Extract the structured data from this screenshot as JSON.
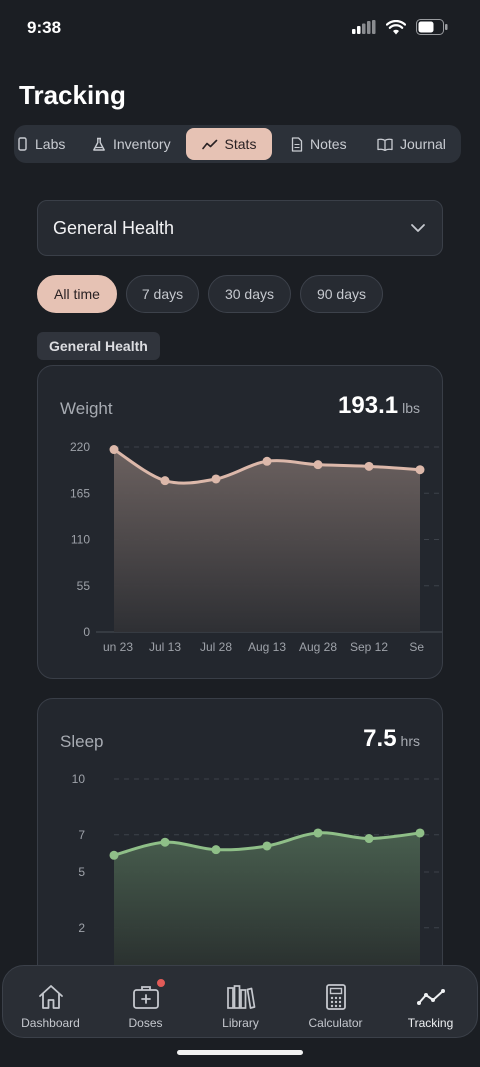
{
  "status": {
    "time": "9:38"
  },
  "page": {
    "title": "Tracking"
  },
  "tabs": [
    {
      "label": "Labs",
      "icon": "lab-icon"
    },
    {
      "label": "Inventory",
      "icon": "flask-icon"
    },
    {
      "label": "Stats",
      "icon": "trend-icon",
      "active": true
    },
    {
      "label": "Notes",
      "icon": "note-icon"
    },
    {
      "label": "Journal",
      "icon": "book-icon"
    }
  ],
  "selector": {
    "value": "General Health"
  },
  "ranges": [
    {
      "label": "All time",
      "active": true
    },
    {
      "label": "7 days"
    },
    {
      "label": "30 days"
    },
    {
      "label": "90 days"
    }
  ],
  "section": {
    "label": "General Health"
  },
  "colors": {
    "accent": "#e6c2b4",
    "weight_line": "#dcb8aa",
    "sleep_line": "#8fbf88"
  },
  "weight_card": {
    "title": "Weight",
    "value": "193.1",
    "unit": "lbs"
  },
  "sleep_card": {
    "title": "Sleep",
    "value": "7.5",
    "unit": "hrs"
  },
  "chart_data": [
    {
      "type": "area",
      "title": "Weight",
      "categories": [
        "un 23",
        "Jul 13",
        "Jul 28",
        "Aug 13",
        "Aug 28",
        "Sep 12",
        "Sep"
      ],
      "yticks": [
        0,
        55,
        110,
        165,
        220
      ],
      "ylim": [
        0,
        220
      ],
      "series": [
        {
          "values": [
            217,
            180,
            182,
            203,
            199,
            197,
            193
          ]
        }
      ],
      "grid": true
    },
    {
      "type": "area",
      "title": "Sleep",
      "yticks": [
        2,
        5,
        7,
        10
      ],
      "ylim": [
        0,
        10
      ],
      "series": [
        {
          "values": [
            5.9,
            6.6,
            6.2,
            6.4,
            7.1,
            6.8,
            7.1
          ]
        }
      ],
      "grid": true
    }
  ],
  "nav": [
    {
      "label": "Dashboard",
      "icon": "home-icon"
    },
    {
      "label": "Doses",
      "icon": "medical-kit-icon",
      "badge": true
    },
    {
      "label": "Library",
      "icon": "books-icon"
    },
    {
      "label": "Calculator",
      "icon": "calculator-icon"
    },
    {
      "label": "Tracking",
      "icon": "trend-icon",
      "active": true
    }
  ]
}
